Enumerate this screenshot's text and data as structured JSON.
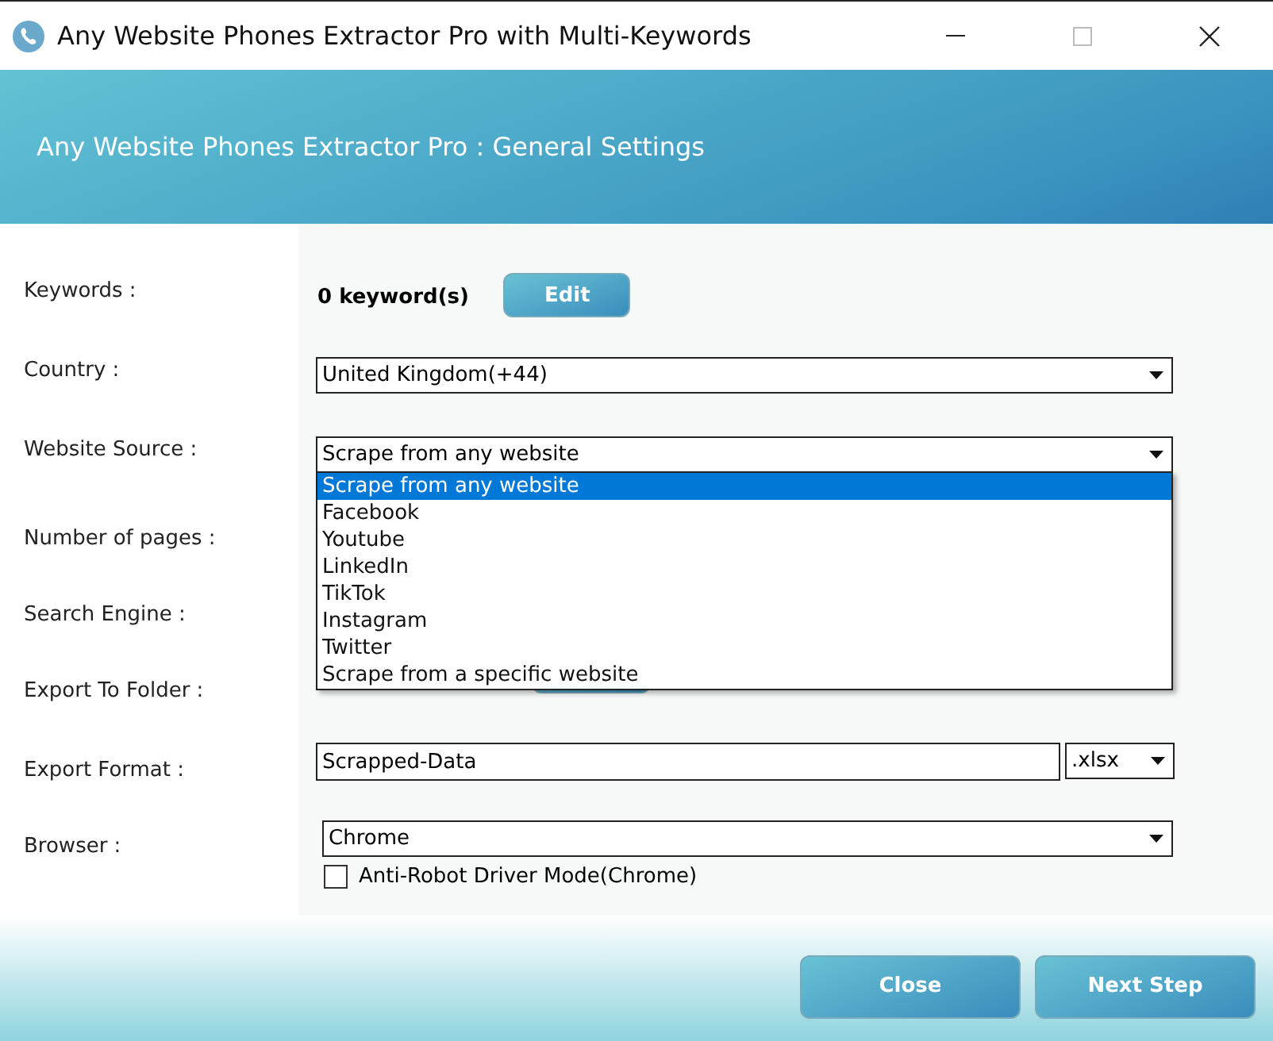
{
  "window": {
    "title": "Any Website Phones Extractor Pro with Multi-Keywords"
  },
  "header": {
    "title": "Any Website Phones Extractor Pro : General Settings"
  },
  "settings": [
    {
      "kind": "keywords",
      "label": "Keywords :",
      "value": "0 keyword(s)",
      "button": "Edit"
    },
    {
      "kind": "select",
      "label": "Country :",
      "value": "United Kingdom(+44)"
    },
    {
      "kind": "select",
      "label": "Website Source :",
      "value": "Scrape from any website",
      "expanded": true,
      "options": [
        {
          "label": "Scrape from any website",
          "selected": true
        },
        {
          "label": "Facebook",
          "selected": false
        },
        {
          "label": "Youtube",
          "selected": false
        },
        {
          "label": "LinkedIn",
          "selected": false
        },
        {
          "label": "TikTok",
          "selected": false
        },
        {
          "label": "Instagram",
          "selected": false
        },
        {
          "label": "Twitter",
          "selected": false
        },
        {
          "label": "Scrape from a specific website",
          "selected": false
        }
      ]
    },
    {
      "kind": "covered",
      "label": "Number of pages :"
    },
    {
      "kind": "covered",
      "label": "Search Engine :"
    },
    {
      "kind": "folder",
      "label": "Export To Folder :"
    },
    {
      "kind": "export",
      "label": "Export Format :",
      "value": "Scrapped-Data",
      "format": ".xlsx"
    },
    {
      "kind": "browser",
      "label": "Browser :",
      "value": "Chrome",
      "checkbox": {
        "label": "Anti-Robot Driver Mode(Chrome)",
        "checked": false
      }
    }
  ],
  "buttons": [
    "Close",
    "Next Step"
  ]
}
